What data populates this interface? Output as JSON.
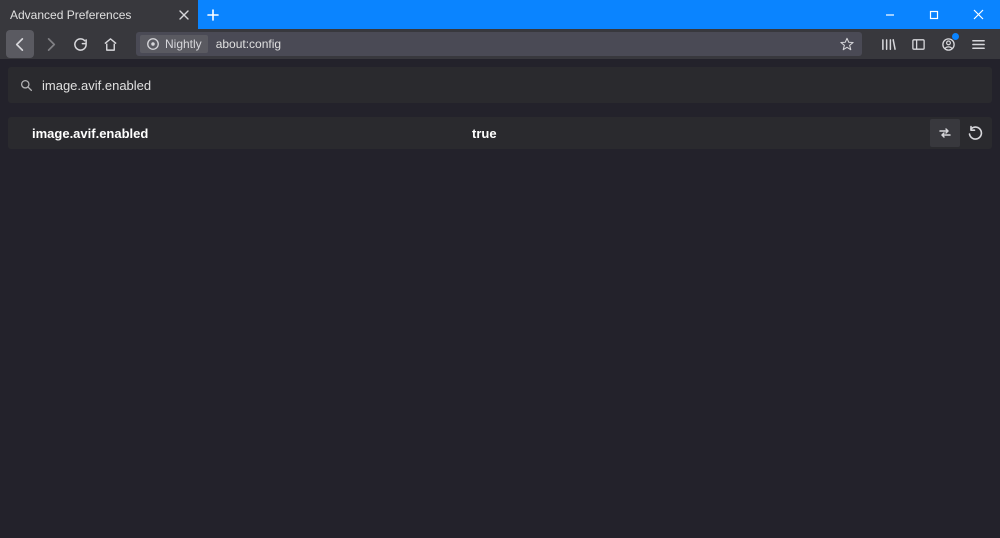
{
  "browser": {
    "channel": "Nightly",
    "tab_title": "Advanced Preferences",
    "url": "about:config"
  },
  "search": {
    "value": "image.avif.enabled"
  },
  "pref": {
    "key": "image.avif.enabled",
    "value": "true"
  }
}
